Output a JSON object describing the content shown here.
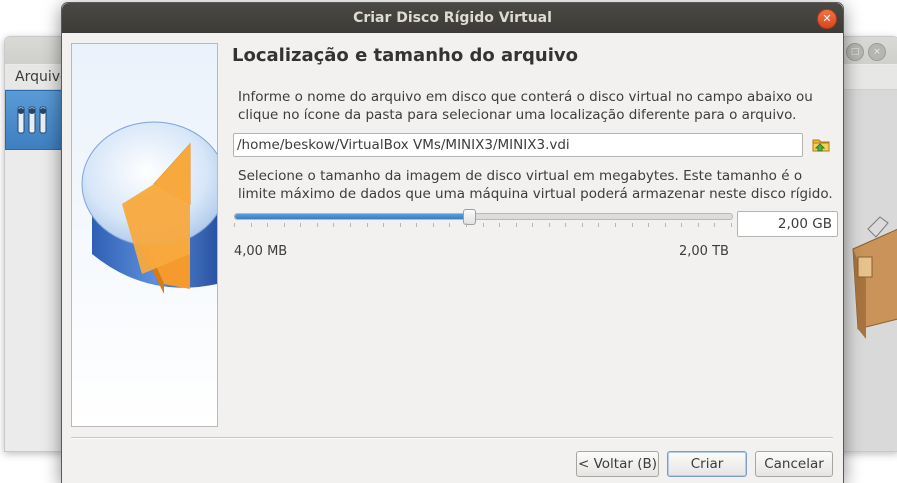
{
  "background_window": {
    "menu_first_item": "Arquivo"
  },
  "dialog": {
    "title": "Criar Disco Rígido Virtual",
    "heading": "Localização e tamanho do arquivo",
    "location_description": "Informe o nome do arquivo em disco que conterá o disco virtual no campo abaixo ou clique no ícone da pasta para selecionar uma localização diferente para o arquivo.",
    "file_path": "/home/beskow/VirtualBox VMs/MINIX3/MINIX3.vdi",
    "size_description": "Selecione o tamanho da imagem de disco virtual em megabytes. Este tamanho é o limite máximo de dados que uma máquina virtual poderá armazenar neste disco rígido.",
    "size_slider_fraction": 0.47,
    "size_value": "2,00 GB",
    "size_min_label": "4,00 MB",
    "size_max_label": "2,00 TB",
    "buttons": {
      "back": "< Voltar (B)",
      "create": "Criar",
      "cancel": "Cancelar"
    }
  },
  "colors": {
    "dialog_titlebar": "#3c3b37",
    "close_button": "#e05a2b",
    "slider_fill": "#3a7cc6"
  }
}
